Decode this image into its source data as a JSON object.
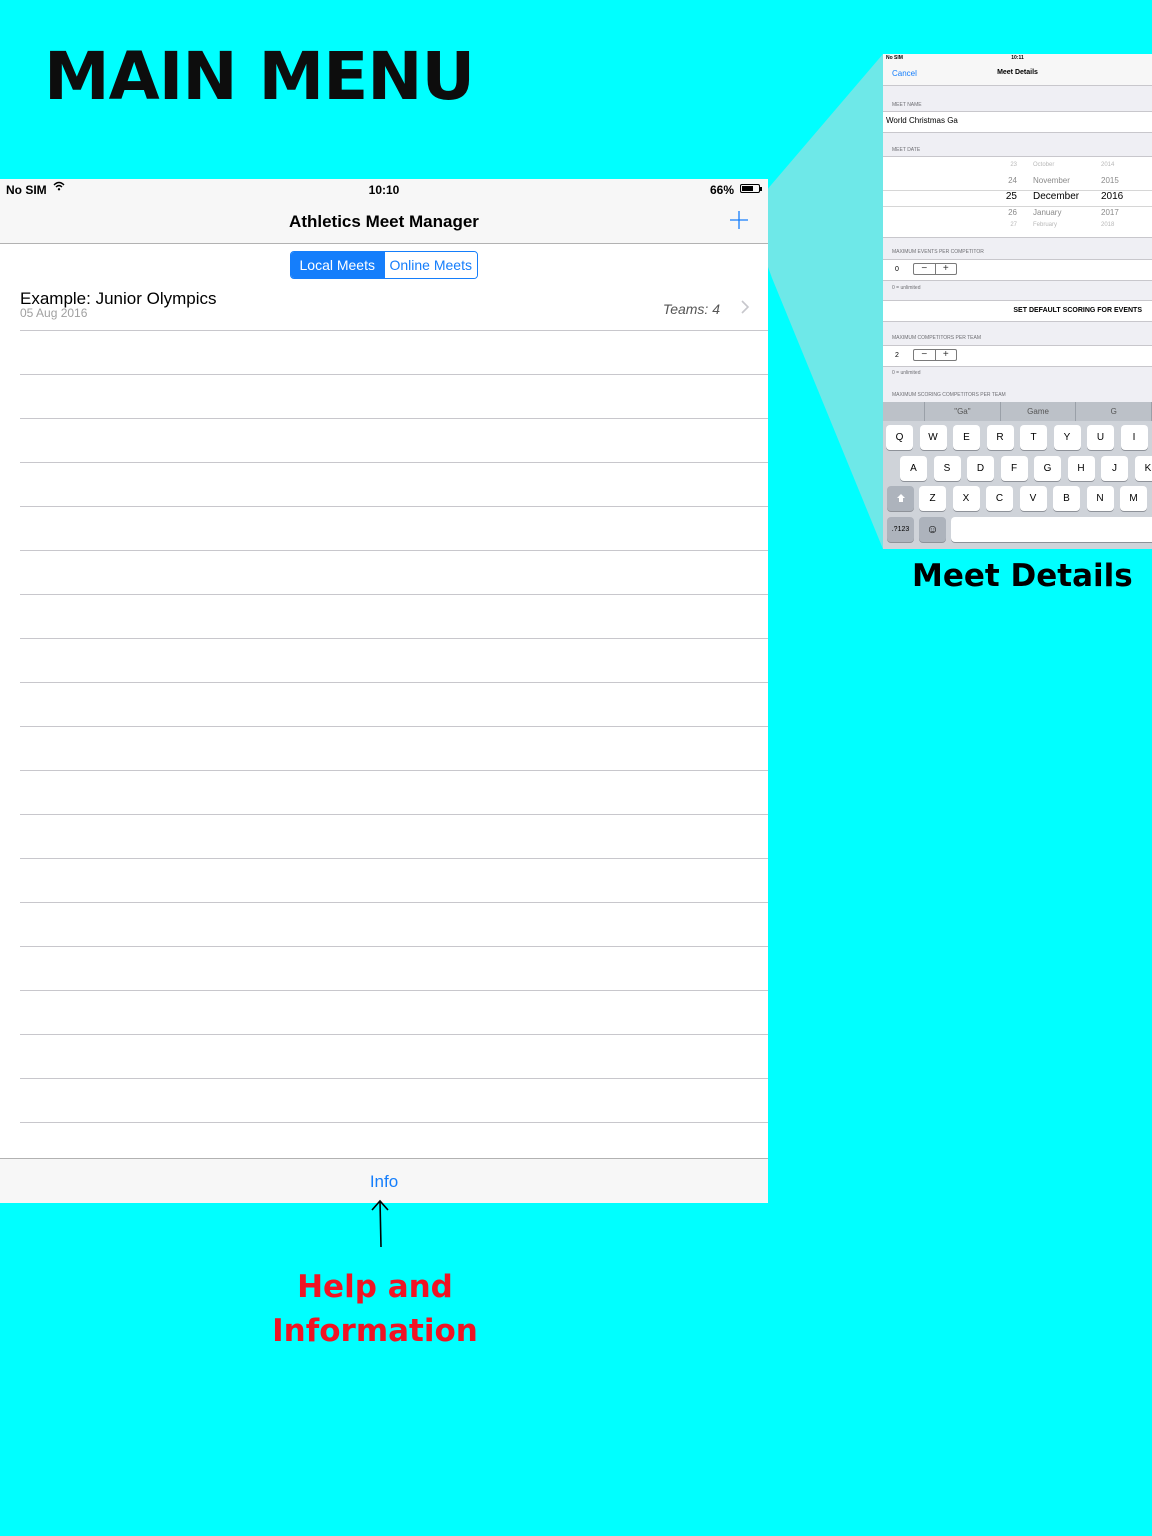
{
  "page": {
    "headline": "MAIN MENU",
    "help_caption_line1": "Help and",
    "help_caption_line2": "Information",
    "details_caption": "Meet Details"
  },
  "colors": {
    "background": "#00ffff",
    "accent": "#157efb",
    "caption_red": "#f01323"
  },
  "status_bar": {
    "carrier": "No SIM",
    "time": "10:10",
    "battery": "66%",
    "battery_level": 0.66
  },
  "nav": {
    "title": "Athletics Meet Manager",
    "add_icon": "plus-icon"
  },
  "segments": {
    "local": "Local Meets",
    "online": "Online Meets",
    "selected": "Local Meets"
  },
  "meets": [
    {
      "name": "Example: Junior Olympics",
      "date": "05 Aug 2016",
      "teams": "Teams: 4"
    }
  ],
  "tab_bar": {
    "info": "Info"
  },
  "details": {
    "status_carrier": "No SIM",
    "status_time": "10:11",
    "cancel": "Cancel",
    "title": "Meet Details",
    "meet_name_label": "MEET NAME",
    "meet_name_value": "World Christmas Ga",
    "meet_date_label": "MEET DATE",
    "picker_rows": [
      {
        "day": "23",
        "month": "October",
        "year": "2014"
      },
      {
        "day": "24",
        "month": "November",
        "year": "2015"
      },
      {
        "day": "25",
        "month": "December",
        "year": "2016"
      },
      {
        "day": "26",
        "month": "January",
        "year": "2017"
      },
      {
        "day": "27",
        "month": "February",
        "year": "2018"
      }
    ],
    "max_events_label": "MAXIMUM EVENTS PER COMPETITOR",
    "max_events_value": "0",
    "unlimited_hint": "0 = unlimited",
    "scoring_button": "SET DEFAULT SCORING FOR EVENTS",
    "max_competitors_label": "MAXIMUM COMPETITORS PER TEAM",
    "max_competitors_value": "2",
    "max_scoring_label": "MAXIMUM SCORING COMPETITORS PER TEAM",
    "suggestions": [
      "",
      "\"Ga\"",
      "Game",
      "G"
    ],
    "keys_row1": [
      "Q",
      "W",
      "E",
      "R",
      "T",
      "Y",
      "U",
      "I"
    ],
    "keys_row2": [
      "A",
      "S",
      "D",
      "F",
      "G",
      "H",
      "J",
      "K"
    ],
    "keys_row3": [
      "Z",
      "X",
      "C",
      "V",
      "B",
      "N",
      "M"
    ],
    "numbers_key": ".?123",
    "emoji_key": "☺",
    "minus": "−",
    "plus": "+"
  }
}
